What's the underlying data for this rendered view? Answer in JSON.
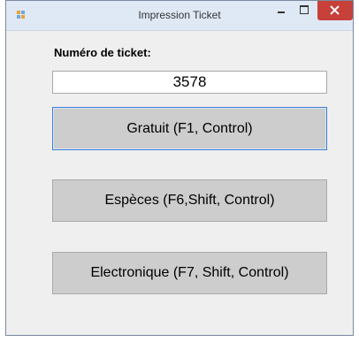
{
  "window": {
    "title": "Impression Ticket",
    "controls": {
      "minimize_icon": "minimize-icon",
      "maximize_icon": "maximize-icon",
      "close_icon": "close-icon"
    },
    "close_color": "#c7403a"
  },
  "form": {
    "ticket_label": "Numéro de ticket:",
    "ticket_value": "3578"
  },
  "buttons": {
    "free": "Gratuit (F1, Control)",
    "cash": "Espèces (F6,Shift, Control)",
    "electronic": "Electronique (F7, Shift, Control)"
  }
}
